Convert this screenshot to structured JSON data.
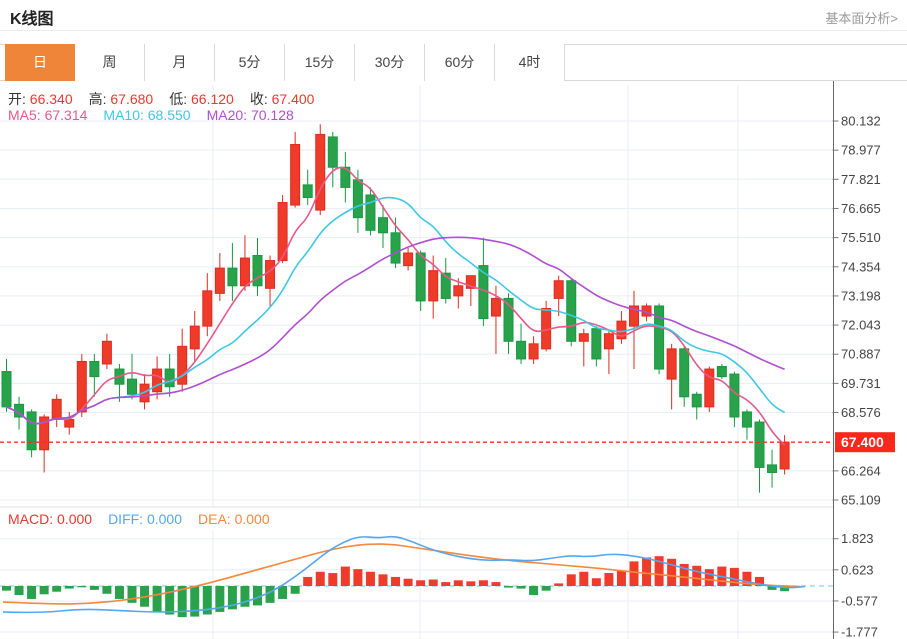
{
  "header": {
    "title": "K线图",
    "link": "基本面分析>"
  },
  "tabs": [
    {
      "label": "日",
      "active": true
    },
    {
      "label": "周",
      "active": false
    },
    {
      "label": "月",
      "active": false
    },
    {
      "label": "5分",
      "active": false
    },
    {
      "label": "15分",
      "active": false
    },
    {
      "label": "30分",
      "active": false
    },
    {
      "label": "60分",
      "active": false
    },
    {
      "label": "4时",
      "active": false
    }
  ],
  "quote_bar": {
    "items": [
      {
        "label": "开:",
        "value": "66.340"
      },
      {
        "label": "高:",
        "value": "67.680"
      },
      {
        "label": "低:",
        "value": "66.120"
      },
      {
        "label": "收:",
        "value": "67.400"
      }
    ]
  },
  "ma_bar": {
    "items": [
      {
        "label": "MA5:",
        "value": "67.314",
        "color": "#e8588a"
      },
      {
        "label": "MA10:",
        "value": "68.550",
        "color": "#3ec7e6"
      },
      {
        "label": "MA20:",
        "value": "70.128",
        "color": "#b04fd0"
      }
    ]
  },
  "macd_bar": {
    "items": [
      {
        "label": "MACD:",
        "value": "0.000",
        "color": "#e8382e"
      },
      {
        "label": "DIFF:",
        "value": "0.000",
        "color": "#54a7ef"
      },
      {
        "label": "DEA:",
        "value": "0.000",
        "color": "#f5883c"
      }
    ]
  },
  "chart_data": {
    "type": "candlestick+macd",
    "title": "K线图 daily candles",
    "legend": [
      "MA5",
      "MA10",
      "MA20",
      "MACD",
      "DIFF",
      "DEA"
    ],
    "main": {
      "y_ticks": [
        80.132,
        78.977,
        77.821,
        76.665,
        75.51,
        74.354,
        73.198,
        72.043,
        70.887,
        69.731,
        68.576,
        66.264,
        65.109
      ],
      "ylim": [
        64.6,
        80.9
      ],
      "price_line": {
        "value": 67.4,
        "label": "67.400"
      },
      "x_grid": [
        213,
        420,
        628,
        738
      ],
      "ma_periods": [
        5,
        10,
        20
      ],
      "candles_format": [
        "open",
        "high",
        "low",
        "close"
      ],
      "candles": [
        [
          70.2,
          70.7,
          68.6,
          68.8
        ],
        [
          68.9,
          69.2,
          67.9,
          68.4
        ],
        [
          68.6,
          68.7,
          66.8,
          67.1
        ],
        [
          67.1,
          68.5,
          66.2,
          68.4
        ],
        [
          68.3,
          69.3,
          68.0,
          69.1
        ],
        [
          68.0,
          68.6,
          67.7,
          68.3
        ],
        [
          68.6,
          70.9,
          68.4,
          70.6
        ],
        [
          70.6,
          70.9,
          69.2,
          70.0
        ],
        [
          70.5,
          71.7,
          70.3,
          71.4
        ],
        [
          70.3,
          70.5,
          69.0,
          69.7
        ],
        [
          69.9,
          70.9,
          69.1,
          69.3
        ],
        [
          69.0,
          70.1,
          68.7,
          69.7
        ],
        [
          69.4,
          70.8,
          69.1,
          70.3
        ],
        [
          70.3,
          70.9,
          69.2,
          69.6
        ],
        [
          69.7,
          71.9,
          69.4,
          71.2
        ],
        [
          71.1,
          72.6,
          70.6,
          72.0
        ],
        [
          72.0,
          74.1,
          71.6,
          73.4
        ],
        [
          73.3,
          74.9,
          73.0,
          74.3
        ],
        [
          74.3,
          75.3,
          73.0,
          73.6
        ],
        [
          73.6,
          75.6,
          73.4,
          74.7
        ],
        [
          74.8,
          75.5,
          73.2,
          73.6
        ],
        [
          73.5,
          74.8,
          72.8,
          74.6
        ],
        [
          74.6,
          77.2,
          74.5,
          76.9
        ],
        [
          76.8,
          79.7,
          76.7,
          79.2
        ],
        [
          77.6,
          78.2,
          76.8,
          77.1
        ],
        [
          76.6,
          80.0,
          76.4,
          79.6
        ],
        [
          79.5,
          79.7,
          77.5,
          78.3
        ],
        [
          78.3,
          78.9,
          76.9,
          77.5
        ],
        [
          77.8,
          78.2,
          75.7,
          76.3
        ],
        [
          77.2,
          77.5,
          75.6,
          75.8
        ],
        [
          76.3,
          76.8,
          75.1,
          75.7
        ],
        [
          75.7,
          76.3,
          74.3,
          74.5
        ],
        [
          74.4,
          75.1,
          74.2,
          74.9
        ],
        [
          74.9,
          75.0,
          72.6,
          73.0
        ],
        [
          73.0,
          74.8,
          72.3,
          74.2
        ],
        [
          74.1,
          74.7,
          72.9,
          73.1
        ],
        [
          73.2,
          73.9,
          72.7,
          73.6
        ],
        [
          73.5,
          74.0,
          72.8,
          74.0
        ],
        [
          74.4,
          75.5,
          72.0,
          72.3
        ],
        [
          72.4,
          73.6,
          70.9,
          73.1
        ],
        [
          73.1,
          73.3,
          70.9,
          71.4
        ],
        [
          71.4,
          72.1,
          70.5,
          70.7
        ],
        [
          70.7,
          71.6,
          70.5,
          71.3
        ],
        [
          71.1,
          73.0,
          71.0,
          72.7
        ],
        [
          73.1,
          74.0,
          72.4,
          73.8
        ],
        [
          73.8,
          73.9,
          71.2,
          71.4
        ],
        [
          71.4,
          71.9,
          70.4,
          71.7
        ],
        [
          71.9,
          72.0,
          70.4,
          70.7
        ],
        [
          71.1,
          71.8,
          70.1,
          71.7
        ],
        [
          71.5,
          72.6,
          71.3,
          72.2
        ],
        [
          72.0,
          73.4,
          70.3,
          72.8
        ],
        [
          72.4,
          72.9,
          72.2,
          72.8
        ],
        [
          72.8,
          72.9,
          70.1,
          70.3
        ],
        [
          69.9,
          71.3,
          68.7,
          71.1
        ],
        [
          71.1,
          71.2,
          68.8,
          69.2
        ],
        [
          69.3,
          69.4,
          68.3,
          68.8
        ],
        [
          68.8,
          70.4,
          68.6,
          70.3
        ],
        [
          70.4,
          70.5,
          69.9,
          70.0
        ],
        [
          70.1,
          70.2,
          68.0,
          68.4
        ],
        [
          68.6,
          68.7,
          67.5,
          68.0
        ],
        [
          68.2,
          68.3,
          65.4,
          66.4
        ],
        [
          66.5,
          67.1,
          65.6,
          66.2
        ],
        [
          66.34,
          67.68,
          66.12,
          67.4
        ]
      ]
    },
    "macd": {
      "y_ticks": [
        1.823,
        0.623,
        -0.577,
        -1.777
      ],
      "zero_line": 0,
      "bars": [
        -0.18,
        -0.35,
        -0.5,
        -0.32,
        -0.22,
        -0.1,
        -0.05,
        -0.15,
        -0.3,
        -0.5,
        -0.65,
        -0.8,
        -1.0,
        -1.1,
        -1.2,
        -1.18,
        -1.1,
        -1.0,
        -0.9,
        -0.8,
        -0.75,
        -0.65,
        -0.5,
        -0.3,
        0.35,
        0.55,
        0.5,
        0.75,
        0.65,
        0.55,
        0.45,
        0.35,
        0.28,
        0.22,
        0.25,
        0.15,
        0.22,
        0.18,
        0.22,
        0.15,
        -0.06,
        -0.1,
        -0.35,
        -0.18,
        0.1,
        0.45,
        0.55,
        0.3,
        0.5,
        0.6,
        0.95,
        1.1,
        1.15,
        1.05,
        0.85,
        0.78,
        0.65,
        0.75,
        0.7,
        0.55,
        0.35,
        -0.15,
        -0.2
      ],
      "diff": [
        [
          3,
          -1.0
        ],
        [
          40,
          -1.05
        ],
        [
          80,
          -0.88
        ],
        [
          120,
          -0.95
        ],
        [
          160,
          -1.02
        ],
        [
          200,
          -0.95
        ],
        [
          230,
          -0.78
        ],
        [
          255,
          -0.5
        ],
        [
          275,
          -0.15
        ],
        [
          295,
          0.35
        ],
        [
          315,
          0.95
        ],
        [
          330,
          1.4
        ],
        [
          345,
          1.72
        ],
        [
          360,
          1.92
        ],
        [
          378,
          1.85
        ],
        [
          395,
          1.93
        ],
        [
          412,
          1.72
        ],
        [
          430,
          1.42
        ],
        [
          450,
          1.2
        ],
        [
          470,
          1.05
        ],
        [
          490,
          0.98
        ],
        [
          510,
          1.02
        ],
        [
          530,
          0.96
        ],
        [
          550,
          1.06
        ],
        [
          570,
          1.18
        ],
        [
          590,
          1.12
        ],
        [
          610,
          1.24
        ],
        [
          630,
          1.18
        ],
        [
          650,
          1.04
        ],
        [
          670,
          0.84
        ],
        [
          690,
          0.62
        ],
        [
          710,
          0.45
        ],
        [
          730,
          0.3
        ],
        [
          750,
          0.14
        ],
        [
          770,
          0.0
        ],
        [
          788,
          -0.08
        ],
        [
          805,
          -0.02
        ]
      ],
      "dea": [
        [
          3,
          -0.62
        ],
        [
          50,
          -0.7
        ],
        [
          90,
          -0.68
        ],
        [
          130,
          -0.52
        ],
        [
          170,
          -0.25
        ],
        [
          210,
          0.12
        ],
        [
          250,
          0.55
        ],
        [
          290,
          0.98
        ],
        [
          320,
          1.3
        ],
        [
          345,
          1.52
        ],
        [
          370,
          1.63
        ],
        [
          395,
          1.6
        ],
        [
          420,
          1.45
        ],
        [
          450,
          1.28
        ],
        [
          480,
          1.12
        ],
        [
          510,
          0.98
        ],
        [
          540,
          0.88
        ],
        [
          570,
          0.78
        ],
        [
          600,
          0.68
        ],
        [
          630,
          0.55
        ],
        [
          660,
          0.44
        ],
        [
          690,
          0.32
        ],
        [
          720,
          0.2
        ],
        [
          750,
          0.08
        ],
        [
          775,
          0.01
        ],
        [
          800,
          -0.02
        ]
      ]
    }
  },
  "colors": {
    "up": "#ee3b2a",
    "up_stroke": "#dd2b1f",
    "down": "#2aa24c",
    "down_stroke": "#14993f",
    "ma5": "#e8588a",
    "ma10": "#3ec7e6",
    "ma20": "#b04fd0",
    "diff": "#54a7ef",
    "dea": "#f5883c",
    "grid": "#e8eef7",
    "axis_line": "#666666",
    "axis_text": "#444444",
    "price_line": "#ff2d1a",
    "price_badge": "#f8291a",
    "zero_dash": "#8fd3f0",
    "separator": "#e0e0e0",
    "tab_active": "#ee8538"
  }
}
